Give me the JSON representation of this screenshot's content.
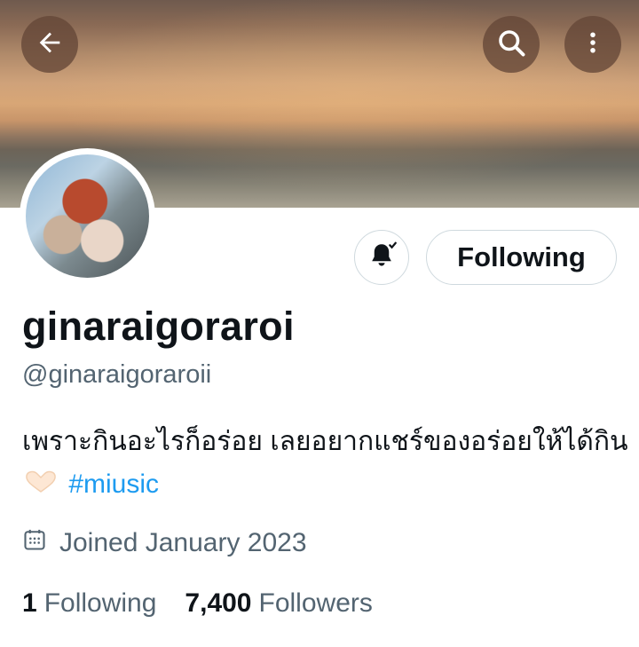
{
  "header": {
    "back_icon": "arrow-left-icon",
    "search_icon": "search-icon",
    "more_icon": "more-vertical-icon"
  },
  "profile": {
    "display_name": "ginaraigoraroi",
    "handle": "@ginaraigoraroii",
    "bio_text": "เพราะกินอะไรก็อร่อย เลยอยากแชร์ของอร่อยให้ได้กิน",
    "bio_emoji": "heart-hands-icon",
    "hashtag": "#miusic",
    "joined": "Joined January 2023"
  },
  "actions": {
    "notifications_icon": "bell-subscribed-icon",
    "follow_label": "Following"
  },
  "stats": {
    "following_count": "1",
    "following_label": "Following",
    "followers_count": "7,400",
    "followers_label": "Followers"
  },
  "colors": {
    "accent": "#1d9bf0",
    "secondary_text": "#536471",
    "primary_text": "#0f1419"
  }
}
